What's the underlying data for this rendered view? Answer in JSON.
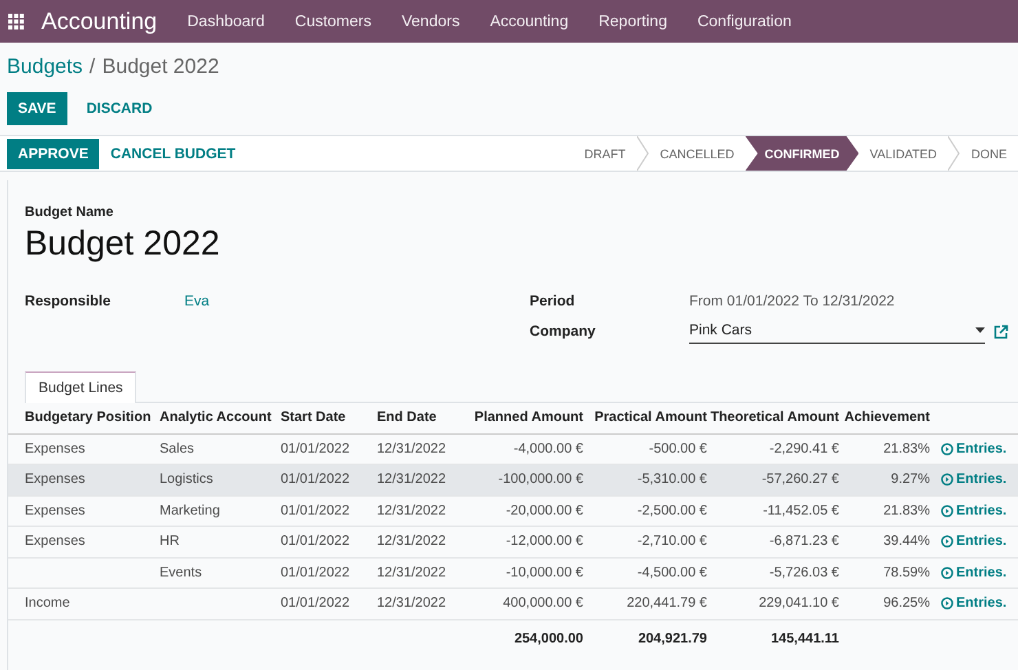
{
  "navbar": {
    "app_name": "Accounting",
    "menu": [
      "Dashboard",
      "Customers",
      "Vendors",
      "Accounting",
      "Reporting",
      "Configuration"
    ]
  },
  "breadcrumb": {
    "parent": "Budgets",
    "separator": "/",
    "current": "Budget 2022"
  },
  "actions": [
    {
      "label": "SAVE",
      "kind": "primary"
    },
    {
      "label": "DISCARD",
      "kind": "secondary"
    }
  ],
  "status_bar": {
    "buttons": [
      {
        "label": "APPROVE",
        "kind": "primary"
      },
      {
        "label": "CANCEL BUDGET",
        "kind": "secondary"
      }
    ],
    "stages": [
      {
        "label": "DRAFT",
        "selected": false
      },
      {
        "label": "CANCELLED",
        "selected": false
      },
      {
        "label": "CONFIRMED",
        "selected": true
      },
      {
        "label": "VALIDATED",
        "selected": false
      },
      {
        "label": "DONE",
        "selected": false
      }
    ]
  },
  "form": {
    "name_label": "Budget Name",
    "name": "Budget 2022",
    "left_fields": [
      {
        "label": "Responsible",
        "value": "Eva",
        "kind": "link"
      }
    ],
    "right_fields": [
      {
        "label": "Period",
        "value": "From 01/01/2022  To 12/31/2022",
        "kind": "text"
      },
      {
        "label": "Company",
        "value": "Pink Cars",
        "kind": "select"
      }
    ]
  },
  "tabs": [
    {
      "label": "Budget Lines",
      "selected": true
    }
  ],
  "table": {
    "columns": [
      "Budgetary Position",
      "Analytic Account",
      "Start Date",
      "End Date",
      "Planned Amount",
      "Practical Amount",
      "Theoretical Amount",
      "Achievement"
    ],
    "rows": [
      {
        "position": "Expenses",
        "account": "Sales",
        "start": "01/01/2022",
        "end": "12/31/2022",
        "planned": "-4,000.00 €",
        "practical": "-500.00 €",
        "theoretical": "-2,290.41 €",
        "achievement": "21.83%",
        "action": "Entries.",
        "hovered": false
      },
      {
        "position": "Expenses",
        "account": "Logistics",
        "start": "01/01/2022",
        "end": "12/31/2022",
        "planned": "-100,000.00 €",
        "practical": "-5,310.00 €",
        "theoretical": "-57,260.27 €",
        "achievement": "9.27%",
        "action": "Entries.",
        "hovered": true
      },
      {
        "position": "Expenses",
        "account": "Marketing",
        "start": "01/01/2022",
        "end": "12/31/2022",
        "planned": "-20,000.00 €",
        "practical": "-2,500.00 €",
        "theoretical": "-11,452.05 €",
        "achievement": "21.83%",
        "action": "Entries.",
        "hovered": false
      },
      {
        "position": "Expenses",
        "account": "HR",
        "start": "01/01/2022",
        "end": "12/31/2022",
        "planned": "-12,000.00 €",
        "practical": "-2,710.00 €",
        "theoretical": "-6,871.23 €",
        "achievement": "39.44%",
        "action": "Entries.",
        "hovered": false
      },
      {
        "position": "",
        "account": "Events",
        "start": "01/01/2022",
        "end": "12/31/2022",
        "planned": "-10,000.00 €",
        "practical": "-4,500.00 €",
        "theoretical": "-5,726.03 €",
        "achievement": "78.59%",
        "action": "Entries.",
        "hovered": false
      },
      {
        "position": "Income",
        "account": "",
        "start": "01/01/2022",
        "end": "12/31/2022",
        "planned": "400,000.00 €",
        "practical": "220,441.79 €",
        "theoretical": "229,041.10 €",
        "achievement": "96.25%",
        "action": "Entries.",
        "hovered": false
      }
    ],
    "totals": {
      "planned": "254,000.00",
      "practical": "204,921.79",
      "theoretical": "145,441.11"
    }
  }
}
